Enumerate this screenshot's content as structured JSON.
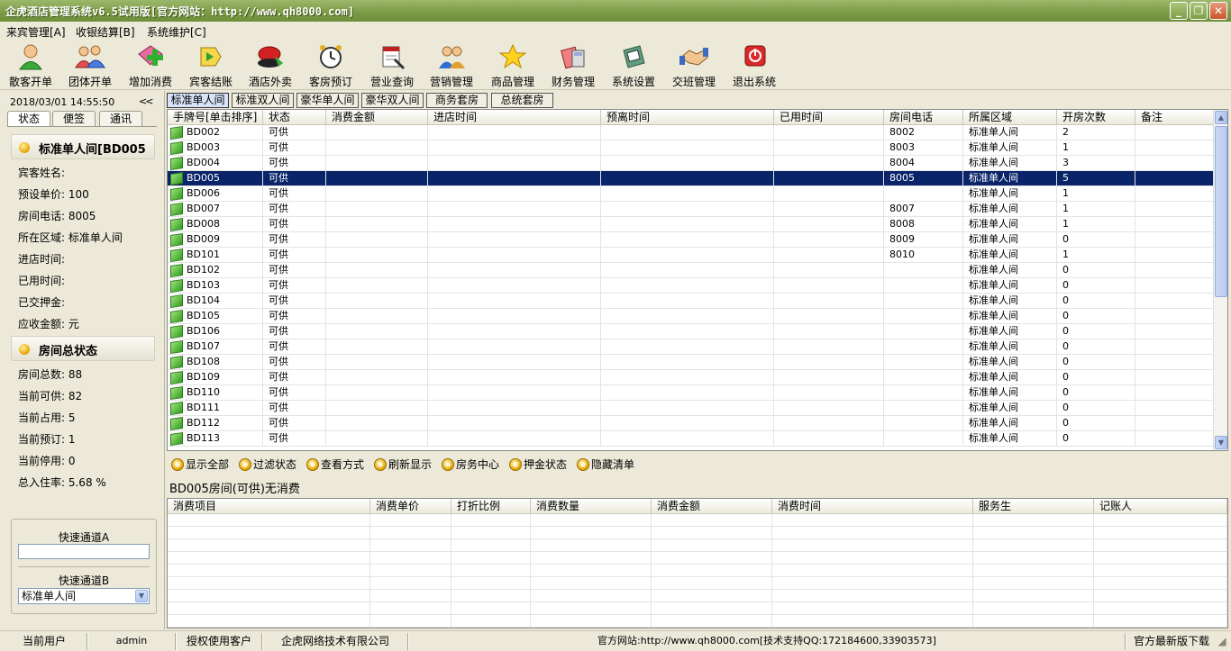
{
  "window": {
    "title": "企虎酒店管理系统v6.5试用版[官方网站：http://www.qh8000.com]"
  },
  "menu": [
    {
      "label": "来宾管理[A]"
    },
    {
      "label": "收银结算[B]"
    },
    {
      "label": "系统维护[C]"
    }
  ],
  "toolbar": [
    {
      "label": "散客开单",
      "icon": "guest-icon"
    },
    {
      "label": "团体开单",
      "icon": "group-icon"
    },
    {
      "label": "增加消费",
      "icon": "add-consume-icon"
    },
    {
      "label": "宾客结账",
      "icon": "checkout-icon"
    },
    {
      "label": "酒店外卖",
      "icon": "takeaway-icon"
    },
    {
      "label": "客房预订",
      "icon": "alarm-clock-icon"
    },
    {
      "label": "营业查询",
      "icon": "report-icon"
    },
    {
      "label": "营销管理",
      "icon": "marketing-icon"
    },
    {
      "label": "商品管理",
      "icon": "star-icon"
    },
    {
      "label": "财务管理",
      "icon": "finance-icon"
    },
    {
      "label": "系统设置",
      "icon": "settings-icon"
    },
    {
      "label": "交班管理",
      "icon": "handshake-icon"
    },
    {
      "label": "退出系统",
      "icon": "power-icon"
    }
  ],
  "left": {
    "datetime": "2018/03/01  14:55:50",
    "collapse": "<<",
    "tabs": [
      "状态",
      "便签",
      "通讯"
    ],
    "room_section": {
      "title": "标准单人间[BD005",
      "lines": [
        "宾客姓名:",
        "预设单价: 100",
        "房间电话: 8005",
        "所在区域: 标准单人间",
        "进店时间:",
        "已用时间:",
        "已交押金:",
        "应收金额: 元"
      ]
    },
    "status_section": {
      "title": "房间总状态",
      "lines": [
        "房间总数: 88",
        "当前可供: 82",
        "当前占用: 5",
        "当前预订: 1",
        "当前停用: 0",
        "总入住率: 5.68 %"
      ]
    },
    "quick": {
      "a_label": "快速通道A",
      "a_value": "",
      "b_label": "快速通道B",
      "b_value": "标准单人间"
    }
  },
  "room_tabs": [
    "标准单人间",
    "标准双人间",
    "豪华单人间",
    "豪华双人间",
    "商务套房",
    "总统套房"
  ],
  "grid": {
    "columns": [
      "手牌号[单击排序]",
      "状态",
      "消费金额",
      "进店时间",
      "预离时间",
      "已用时间",
      "房间电话",
      "所属区域",
      "开房次数",
      "备注"
    ],
    "rows": [
      [
        "BD002",
        "可供",
        "",
        "",
        "",
        "",
        "8002",
        "标准单人间",
        "2",
        ""
      ],
      [
        "BD003",
        "可供",
        "",
        "",
        "",
        "",
        "8003",
        "标准单人间",
        "1",
        ""
      ],
      [
        "BD004",
        "可供",
        "",
        "",
        "",
        "",
        "8004",
        "标准单人间",
        "3",
        ""
      ],
      [
        "BD005",
        "可供",
        "",
        "",
        "",
        "",
        "8005",
        "标准单人间",
        "5",
        ""
      ],
      [
        "BD006",
        "可供",
        "",
        "",
        "",
        "",
        "",
        "标准单人间",
        "1",
        ""
      ],
      [
        "BD007",
        "可供",
        "",
        "",
        "",
        "",
        "8007",
        "标准单人间",
        "1",
        ""
      ],
      [
        "BD008",
        "可供",
        "",
        "",
        "",
        "",
        "8008",
        "标准单人间",
        "1",
        ""
      ],
      [
        "BD009",
        "可供",
        "",
        "",
        "",
        "",
        "8009",
        "标准单人间",
        "0",
        ""
      ],
      [
        "BD101",
        "可供",
        "",
        "",
        "",
        "",
        "8010",
        "标准单人间",
        "1",
        ""
      ],
      [
        "BD102",
        "可供",
        "",
        "",
        "",
        "",
        "",
        "标准单人间",
        "0",
        ""
      ],
      [
        "BD103",
        "可供",
        "",
        "",
        "",
        "",
        "",
        "标准单人间",
        "0",
        ""
      ],
      [
        "BD104",
        "可供",
        "",
        "",
        "",
        "",
        "",
        "标准单人间",
        "0",
        ""
      ],
      [
        "BD105",
        "可供",
        "",
        "",
        "",
        "",
        "",
        "标准单人间",
        "0",
        ""
      ],
      [
        "BD106",
        "可供",
        "",
        "",
        "",
        "",
        "",
        "标准单人间",
        "0",
        ""
      ],
      [
        "BD107",
        "可供",
        "",
        "",
        "",
        "",
        "",
        "标准单人间",
        "0",
        ""
      ],
      [
        "BD108",
        "可供",
        "",
        "",
        "",
        "",
        "",
        "标准单人间",
        "0",
        ""
      ],
      [
        "BD109",
        "可供",
        "",
        "",
        "",
        "",
        "",
        "标准单人间",
        "0",
        ""
      ],
      [
        "BD110",
        "可供",
        "",
        "",
        "",
        "",
        "",
        "标准单人间",
        "0",
        ""
      ],
      [
        "BD111",
        "可供",
        "",
        "",
        "",
        "",
        "",
        "标准单人间",
        "0",
        ""
      ],
      [
        "BD112",
        "可供",
        "",
        "",
        "",
        "",
        "",
        "标准单人间",
        "0",
        ""
      ],
      [
        "BD113",
        "可供",
        "",
        "",
        "",
        "",
        "",
        "标准单人间",
        "0",
        ""
      ]
    ],
    "selected_row": 3
  },
  "grid_tools": [
    "显示全部",
    "过滤状态",
    "查看方式",
    "刷新显示",
    "房务中心",
    "押金状态",
    "隐藏清单"
  ],
  "consume": {
    "title": "BD005房间(可供)无消费",
    "columns": [
      "消费项目",
      "消费单价",
      "打折比例",
      "消费数量",
      "消费金额",
      "消费时间",
      "服务生",
      "记账人"
    ]
  },
  "status": {
    "user_label": "当前用户",
    "user": "admin",
    "license_label": "授权使用客户",
    "company": "企虎网络技术有限公司",
    "website": "官方网站:http://www.qh8000.com[技术支持QQ:172184600,33903573]",
    "update": "官方最新版下载"
  },
  "colors": {
    "selected_row": "#0A246A",
    "title_bar": "#7A9A45",
    "face": "#ECE9D8"
  }
}
